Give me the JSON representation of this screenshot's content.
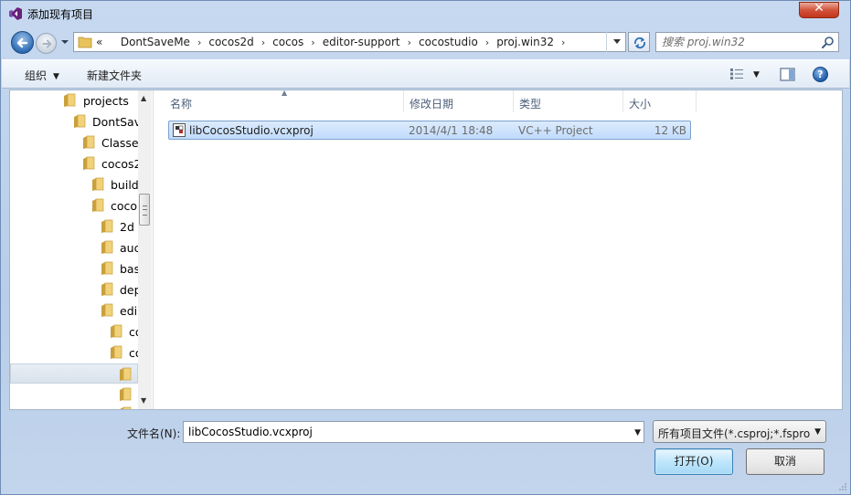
{
  "window": {
    "title": "添加现有项目",
    "close_label": "✕"
  },
  "address": {
    "prefix": "«",
    "crumbs": [
      "DontSaveMe",
      "cocos2d",
      "cocos",
      "editor-support",
      "cocostudio",
      "proj.win32"
    ],
    "separator": "›"
  },
  "search": {
    "placeholder": "搜索 proj.win32"
  },
  "toolbar": {
    "organize_label": "组织",
    "new_folder_label": "新建文件夹"
  },
  "tree": {
    "items": [
      {
        "label": "projects"
      },
      {
        "label": "DontSave"
      },
      {
        "label": "Classes"
      },
      {
        "label": "cocos2"
      },
      {
        "label": "build"
      },
      {
        "label": "coco"
      },
      {
        "label": "2d"
      },
      {
        "label": "auc"
      },
      {
        "label": "bas"
      },
      {
        "label": "dep"
      },
      {
        "label": "edi"
      },
      {
        "label": "co"
      },
      {
        "label": "co"
      },
      {
        "label": ""
      },
      {
        "label": ""
      },
      {
        "label": ""
      }
    ]
  },
  "columns": {
    "name": "名称",
    "modified": "修改日期",
    "type": "类型",
    "size": "大小"
  },
  "files": [
    {
      "name": "libCocosStudio.vcxproj",
      "modified": "2014/4/1 18:48",
      "type": "VC++ Project",
      "size": "12 KB"
    }
  ],
  "footer": {
    "filename_label": "文件名(N):",
    "filename_value": "libCocosStudio.vcxproj",
    "filetype_value": "所有项目文件(*.csproj;*.fsproj",
    "open_label": "打开(O)",
    "cancel_label": "取消"
  },
  "colors": {
    "selection": "#c1dbfc",
    "accent": "#3c7fb1",
    "folder": "#e8c25a"
  }
}
